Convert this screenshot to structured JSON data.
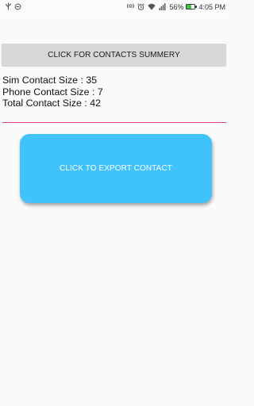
{
  "status_bar": {
    "left_icons": [
      "usb-icon",
      "sync-icon"
    ],
    "right_icons": [
      "nfc-icon",
      "alarm-icon",
      "wifi-icon",
      "signal-icon",
      "battery-icon"
    ],
    "battery_percent_value": 56,
    "battery_percent": "56%",
    "time": "4:05 PM",
    "battery_color": "#3fc43f"
  },
  "summary_button": {
    "label": "CLICK FOR CONTACTS SUMMERY",
    "color": "#d6d7d7"
  },
  "info": {
    "sim": "Sim Contact Size : 35",
    "phone": "Phone Contact Size : 7",
    "total": "Total Contact Size : 42"
  },
  "divider_color": "#e0457b",
  "export_button": {
    "label": "CLICK TO EXPORT CONTACT",
    "color": "#3fc3fa"
  }
}
